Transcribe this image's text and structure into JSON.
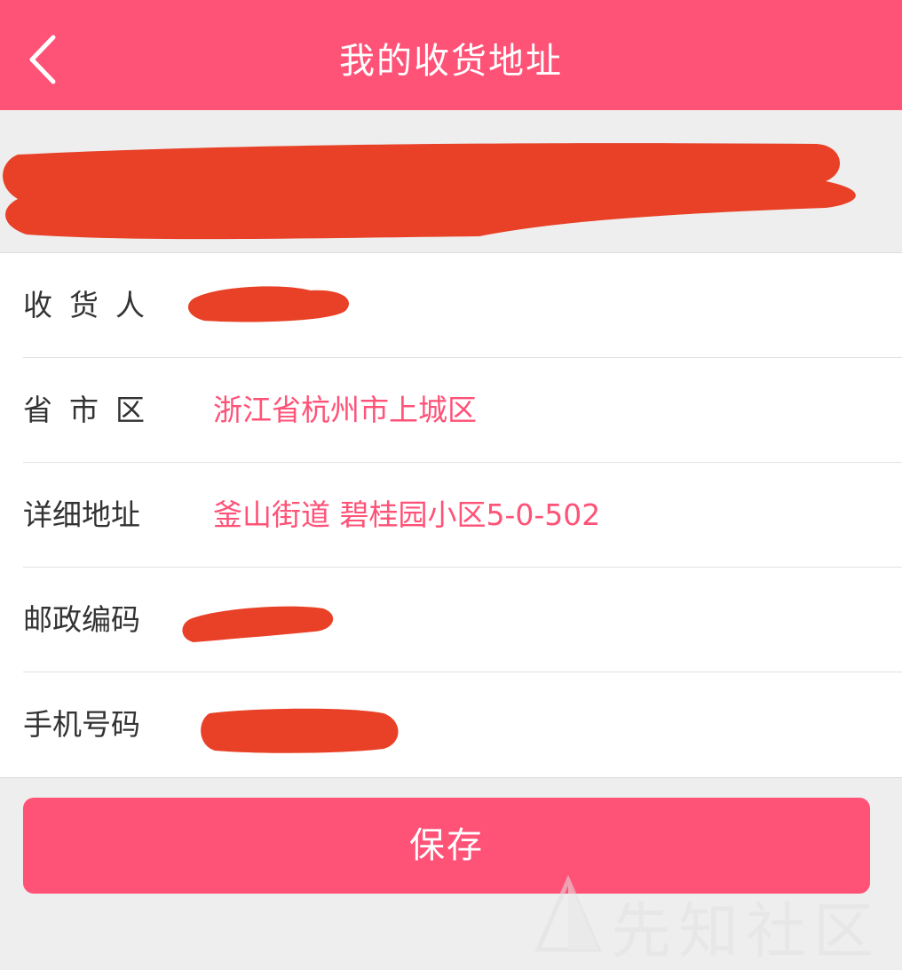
{
  "header": {
    "title": "我的收货地址",
    "back_icon": "chevron-left-icon"
  },
  "form": {
    "recipient_label": "收货人",
    "region_label": "省市区",
    "region_value": "浙江省杭州市上城区",
    "address_label": "详细地址",
    "address_value": "釜山街道 碧桂园小区5-0-502",
    "postcode_label": "邮政编码",
    "phone_label": "手机号码"
  },
  "save_label": "保存",
  "watermark": "先知社区",
  "colors": {
    "accent": "#ff5277",
    "redaction": "#e84127",
    "background": "#eeeeee"
  }
}
